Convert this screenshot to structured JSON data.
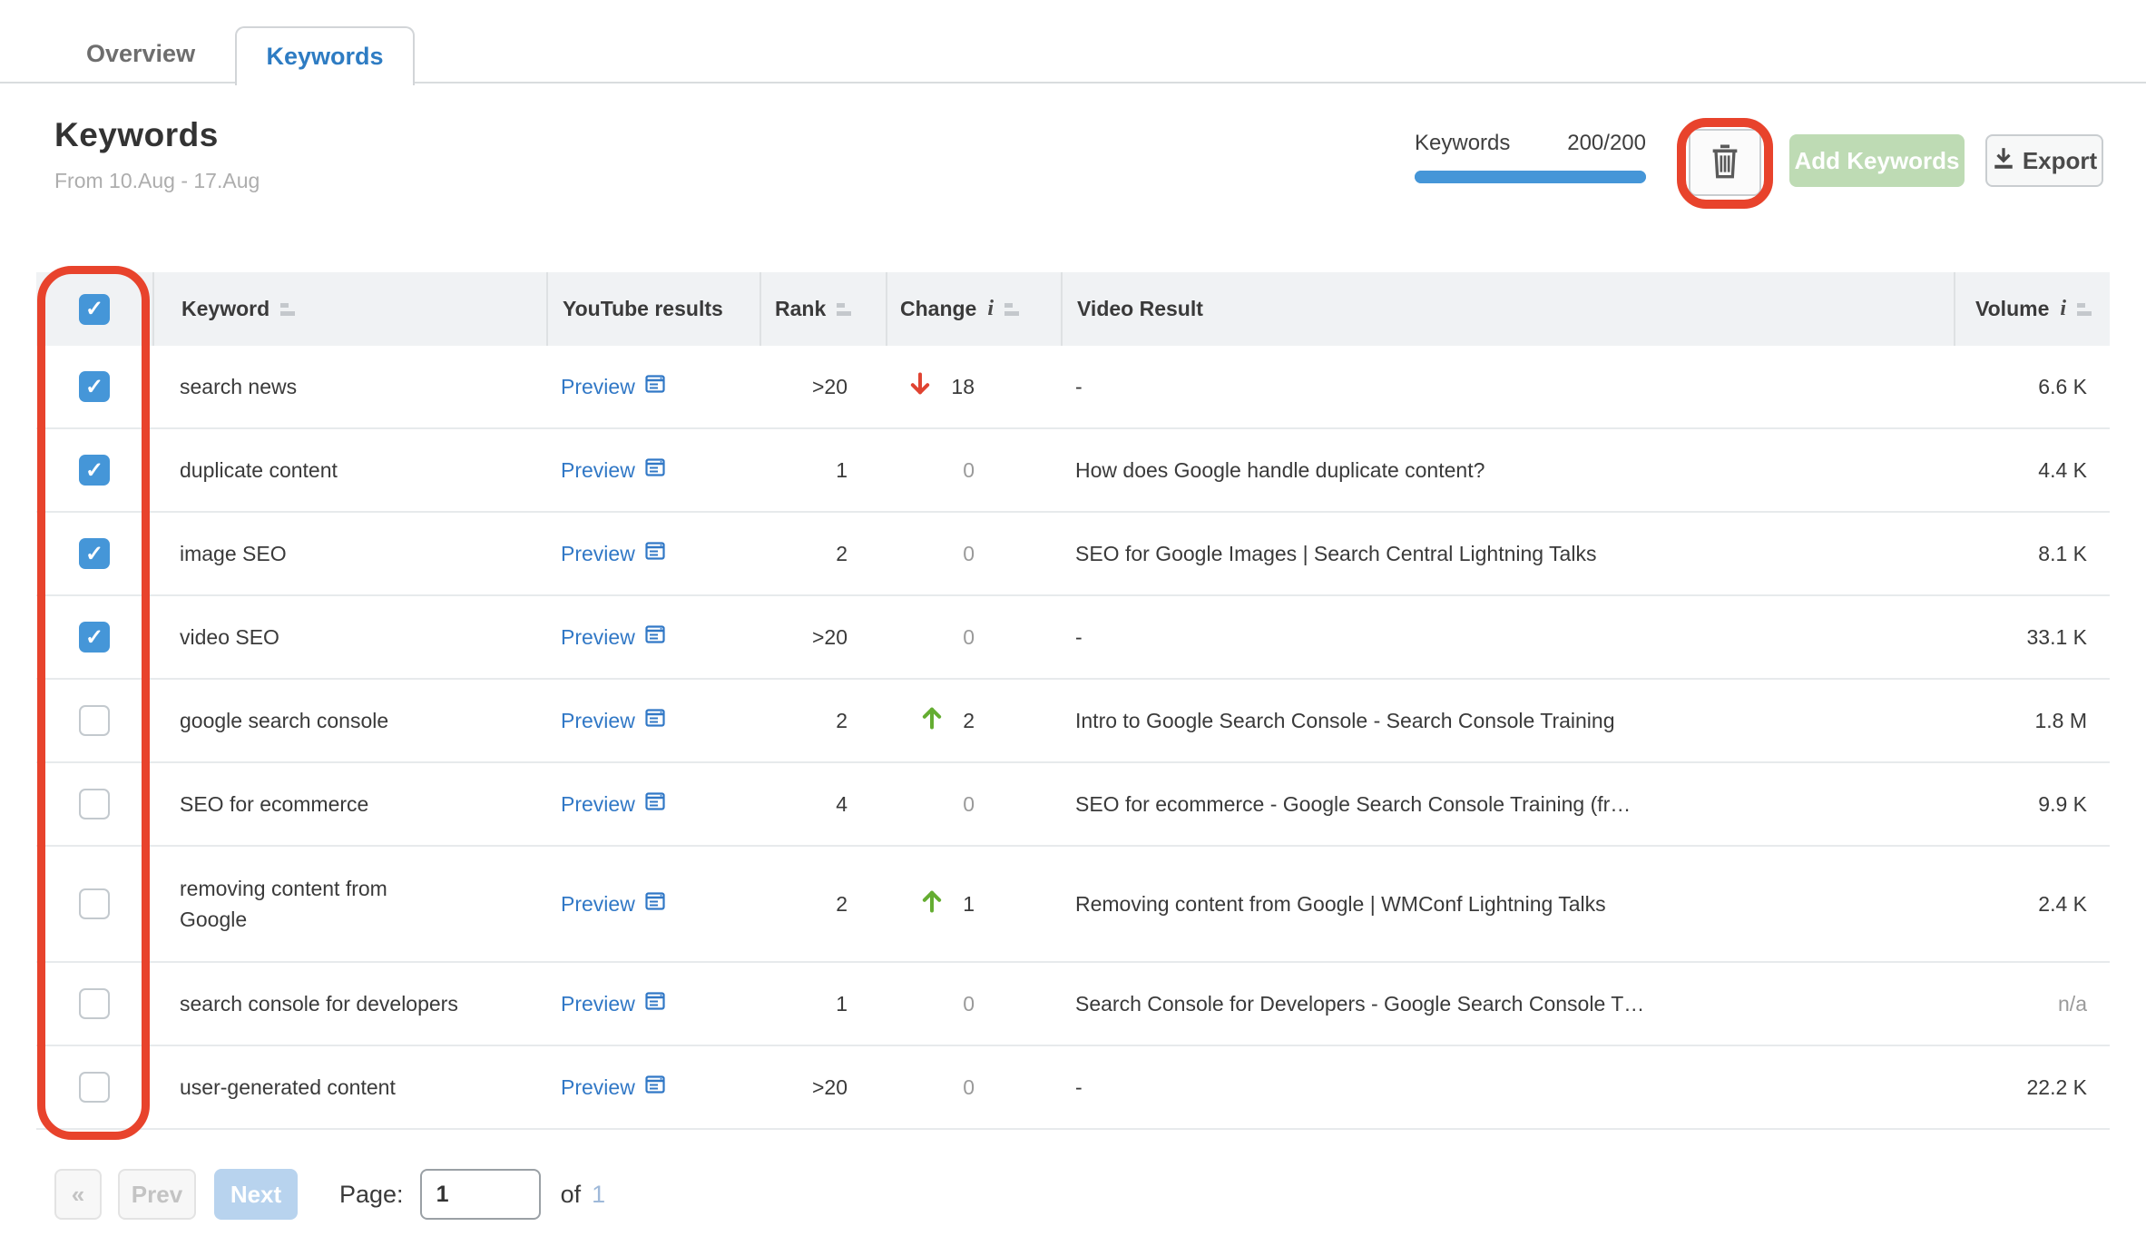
{
  "tabs": {
    "overview": "Overview",
    "keywords": "Keywords"
  },
  "header": {
    "title": "Keywords",
    "date_range": "From 10.Aug - 17.Aug"
  },
  "toolbar": {
    "limit_label": "Keywords",
    "limit_value": "200/200",
    "add_keywords_label": "Add Keywords",
    "export_label": "Export"
  },
  "table": {
    "columns": {
      "keyword": "Keyword",
      "youtube_results": "YouTube results",
      "rank": "Rank",
      "change": "Change",
      "video_result": "Video Result",
      "volume": "Volume"
    },
    "preview_label": "Preview",
    "rows": [
      {
        "checked": true,
        "keyword": "search news",
        "rank": ">20",
        "change": "18",
        "change_dir": "down",
        "video_result": "-",
        "volume": "6.6 K",
        "volume_muted": false
      },
      {
        "checked": true,
        "keyword": "duplicate content",
        "rank": "1",
        "change": "0",
        "change_dir": "none",
        "video_result": "How does Google handle duplicate content?",
        "volume": "4.4 K",
        "volume_muted": false
      },
      {
        "checked": true,
        "keyword": "image SEO",
        "rank": "2",
        "change": "0",
        "change_dir": "none",
        "video_result": "SEO for Google Images | Search Central Lightning Talks",
        "volume": "8.1 K",
        "volume_muted": false
      },
      {
        "checked": true,
        "keyword": "video SEO",
        "rank": ">20",
        "change": "0",
        "change_dir": "none",
        "video_result": "-",
        "volume": "33.1 K",
        "volume_muted": false
      },
      {
        "checked": false,
        "keyword": "google search console",
        "rank": "2",
        "change": "2",
        "change_dir": "up",
        "video_result": "Intro to Google Search Console - Search Console Training",
        "volume": "1.8 M",
        "volume_muted": false
      },
      {
        "checked": false,
        "keyword": "SEO for ecommerce",
        "rank": "4",
        "change": "0",
        "change_dir": "none",
        "video_result": "SEO for ecommerce - Google Search Console Training (fr…",
        "volume": "9.9 K",
        "volume_muted": false
      },
      {
        "checked": false,
        "keyword": "removing content from\nGoogle",
        "rank": "2",
        "change": "1",
        "change_dir": "up",
        "video_result": "Removing content from Google | WMConf Lightning Talks",
        "volume": "2.4 K",
        "volume_muted": false
      },
      {
        "checked": false,
        "keyword": "search console for developers",
        "rank": "1",
        "change": "0",
        "change_dir": "none",
        "video_result": "Search Console for Developers - Google Search Console T…",
        "volume": "n/a",
        "volume_muted": true
      },
      {
        "checked": false,
        "keyword": "user-generated content",
        "rank": ">20",
        "change": "0",
        "change_dir": "none",
        "video_result": "-",
        "volume": "22.2 K",
        "volume_muted": false
      }
    ]
  },
  "pagination": {
    "first_label": "«",
    "prev_label": "Prev",
    "next_label": "Next",
    "page_label": "Page:",
    "page_value": "1",
    "of_label": "of",
    "total_pages": "1"
  },
  "colors": {
    "accent_blue": "#4596d8",
    "link_blue": "#3178c6",
    "active_tab_blue": "#2e7cc3",
    "green_up": "#64ad31",
    "red_down": "#e04331",
    "annotation_red": "#e8432c",
    "add_button_green": "#bedbb4",
    "next_button_blue": "#b8d3ee",
    "header_bg": "#f0f2f4"
  }
}
